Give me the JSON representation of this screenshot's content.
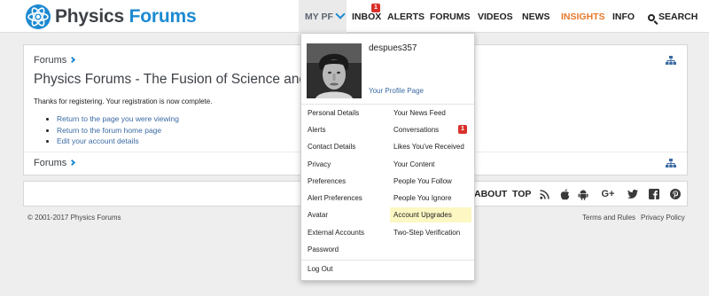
{
  "header": {
    "logo_word1": "Physics",
    "logo_word2": "Forums",
    "nav": {
      "mypf": "MY PF",
      "inbox": "INBOX",
      "inbox_badge": "1",
      "alerts": "ALERTS",
      "forums": "FORUMS",
      "videos": "VIDEOS",
      "news": "NEWS",
      "insights": "INSIGHTS",
      "info": "INFO",
      "search": "SEARCH"
    }
  },
  "main": {
    "breadcrumb": "Forums",
    "title": "Physics Forums - The Fusion of Science and",
    "message": "Thanks for registering. Your registration is now complete.",
    "links": [
      "Return to the page you were viewing",
      "Return to the forum home page",
      "Edit your account details"
    ],
    "breadcrumb_bottom": "Forums"
  },
  "bottombar": {
    "about": "ABOUT",
    "top": "TOP",
    "icons": [
      "rss-icon",
      "apple-icon",
      "android-icon",
      "google-plus-icon",
      "twitter-icon",
      "facebook-icon",
      "pinterest-icon"
    ],
    "google_plus_glyph": "G+"
  },
  "footer": {
    "copyright": "© 2001-2017 Physics Forums",
    "terms": "Terms and Rules",
    "privacy": "Privacy Policy"
  },
  "dropdown": {
    "username": "despues357",
    "profile_link": "Your Profile Page",
    "left_items": [
      "Personal Details",
      "Alerts",
      "Contact Details",
      "Privacy",
      "Preferences",
      "Alert Preferences",
      "Avatar",
      "External Accounts",
      "Password"
    ],
    "right_items": [
      "Your News Feed",
      "Conversations",
      "Likes You've Received",
      "Your Content",
      "People You Follow",
      "People You Ignore",
      "Account Upgrades",
      "Two-Step Verification"
    ],
    "conversations_badge": "1",
    "logout": "Log Out"
  },
  "colors": {
    "brand_blue": "#1c8ad2",
    "insights_orange": "#e8792b",
    "badge_red": "#d9302a",
    "highlight_yellow": "#fcf7c3"
  }
}
